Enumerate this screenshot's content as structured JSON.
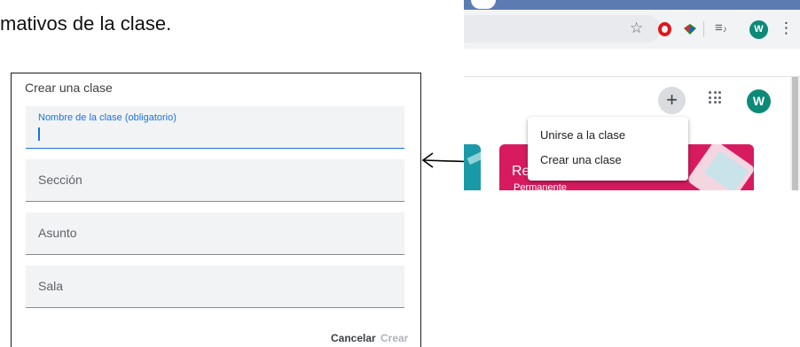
{
  "document": {
    "text": "mativos de la clase."
  },
  "dialog": {
    "title": "Crear una clase",
    "fields": [
      {
        "label": "Nombre de la clase (obligatorio)",
        "value": ""
      },
      {
        "placeholder": "Sección"
      },
      {
        "placeholder": "Asunto"
      },
      {
        "placeholder": "Sala"
      }
    ],
    "cancel_label": "Cancelar",
    "create_label": "Crear"
  },
  "browser": {
    "toolbar": {
      "icons": [
        "star-icon",
        "opera-icon",
        "extension-icon",
        "queue-icon",
        "profile-avatar",
        "kebab-menu-icon"
      ],
      "avatar_letter": "W"
    },
    "content": {
      "plus_symbol": "+",
      "apps_icon": "apps-grid-icon",
      "avatar_letter": "W",
      "menu": {
        "items": [
          "Unirse a la clase",
          "Crear una clase"
        ]
      },
      "card": {
        "title": "Re",
        "subtitle": "Permanente"
      }
    }
  },
  "colors": {
    "accent_blue": "#1a73e8",
    "avatar_teal": "#0b8a78",
    "card_pink": "#d81b60",
    "opera_red": "#e0161d"
  }
}
